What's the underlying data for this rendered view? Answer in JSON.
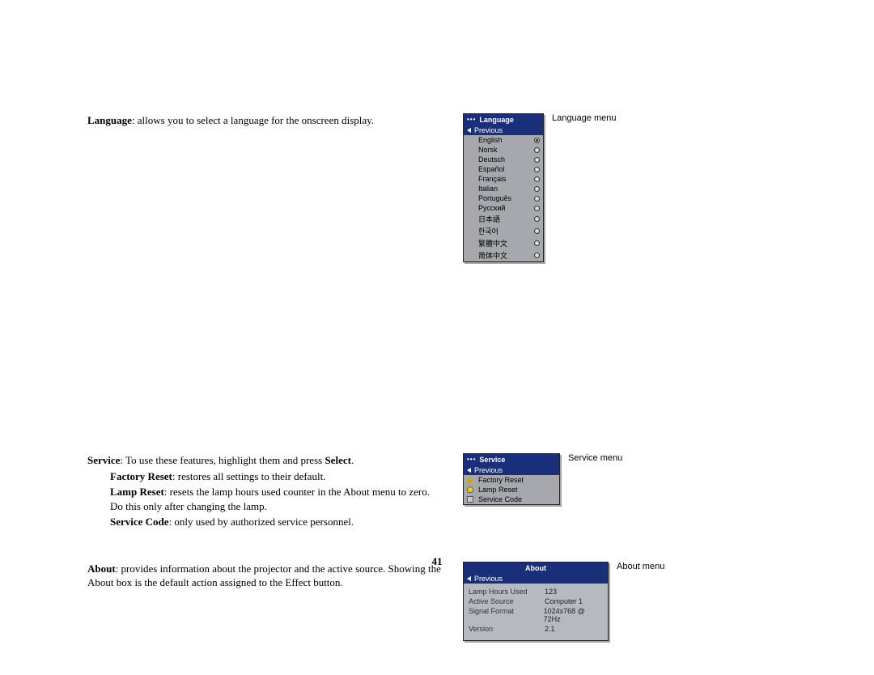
{
  "text": {
    "language_heading": "Language",
    "language_desc": ": allows you to select a language for the onscreen display.",
    "service_heading": "Service",
    "service_desc1": ": To use these features, highlight them and press ",
    "service_desc_bold": "Select",
    "service_desc2": ".",
    "factory_reset_heading": "Factory Reset",
    "factory_reset_desc": ": restores all settings to their default.",
    "lamp_reset_heading": "Lamp Reset",
    "lamp_reset_desc": ": resets the lamp hours used counter in the About menu to zero. Do this only after changing the lamp.",
    "service_code_heading": "Service Code",
    "service_code_desc": ": only used by authorized service personnel.",
    "about_heading": "About",
    "about_desc": ": provides information about the projector and the active source. Showing the About box is the default action assigned to the Effect button."
  },
  "captions": {
    "language": "Language menu",
    "service": "Service menu",
    "about": "About menu"
  },
  "language_menu": {
    "title": "Language",
    "previous": "Previous",
    "items": [
      {
        "label": "English",
        "selected": true
      },
      {
        "label": "Norsk",
        "selected": false
      },
      {
        "label": "Deutsch",
        "selected": false
      },
      {
        "label": "Español",
        "selected": false
      },
      {
        "label": "Français",
        "selected": false
      },
      {
        "label": "Italian",
        "selected": false
      },
      {
        "label": "Português",
        "selected": false
      },
      {
        "label": "Русский",
        "selected": false
      },
      {
        "label": "日本語",
        "selected": false
      },
      {
        "label": "한국어",
        "selected": false
      },
      {
        "label": "繁體中文",
        "selected": false
      },
      {
        "label": "简体中文",
        "selected": false
      }
    ]
  },
  "service_menu": {
    "title": "Service",
    "previous": "Previous",
    "items": [
      {
        "label": "Factory Reset",
        "icon": "warn"
      },
      {
        "label": "Lamp Reset",
        "icon": "bulb"
      },
      {
        "label": "Service Code",
        "icon": "code"
      }
    ]
  },
  "about_menu": {
    "title": "About",
    "previous": "Previous",
    "rows": [
      {
        "key": "Lamp Hours Used",
        "val": "123"
      },
      {
        "key": "Active Source",
        "val": "Computer 1"
      },
      {
        "key": "Signal Format",
        "val": "1024x768 @ 72Hz"
      },
      {
        "key": "Version",
        "val": "2.1"
      }
    ]
  },
  "page_number": "41"
}
